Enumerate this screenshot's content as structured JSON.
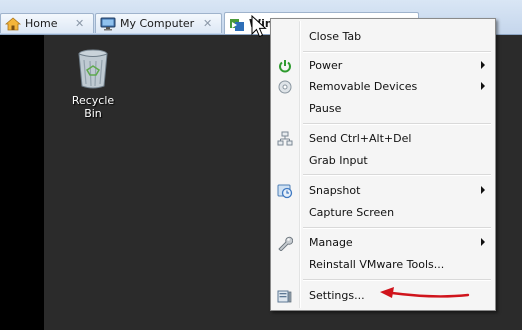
{
  "tabs": [
    {
      "label": "Home",
      "icon": "home-icon"
    },
    {
      "label": "My Computer",
      "icon": "my-computer-icon"
    },
    {
      "label": "Win",
      "icon": "vm-icon"
    }
  ],
  "desktop": {
    "recycle_bin_label": "Recycle Bin"
  },
  "context_menu": {
    "items": [
      {
        "label": "Close Tab"
      },
      {
        "label": "Power",
        "icon": "power-icon",
        "submenu": true
      },
      {
        "label": "Removable Devices",
        "icon": "disc-icon",
        "submenu": true
      },
      {
        "label": "Pause"
      },
      {
        "label": "Send Ctrl+Alt+Del",
        "icon": "network-icon"
      },
      {
        "label": "Grab Input"
      },
      {
        "label": "Snapshot",
        "icon": "snapshot-icon",
        "submenu": true
      },
      {
        "label": "Capture Screen"
      },
      {
        "label": "Manage",
        "icon": "wrench-icon",
        "submenu": true
      },
      {
        "label": "Reinstall VMware Tools..."
      },
      {
        "label": "Settings...",
        "icon": "settings-icon"
      }
    ]
  },
  "colors": {
    "annotation_arrow": "#d0141c",
    "power_green": "#2e9b2e",
    "tab_bar": "#c5d6ec"
  }
}
